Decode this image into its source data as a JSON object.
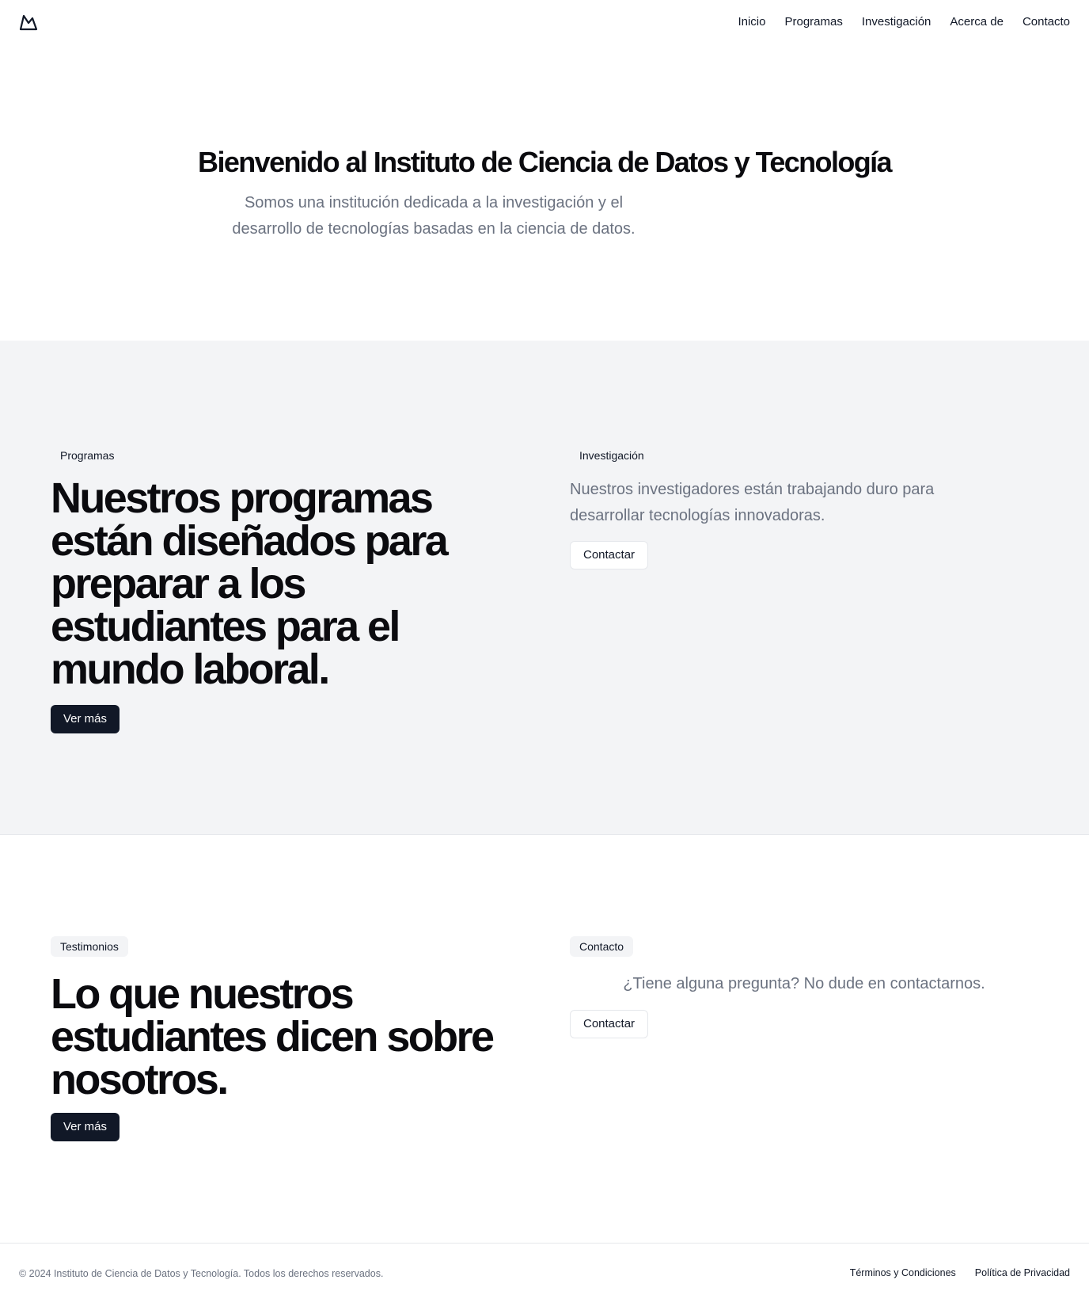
{
  "header": {
    "logo_icon": "mountain-icon",
    "nav": [
      "Inicio",
      "Programas",
      "Investigación",
      "Acerca de",
      "Contacto"
    ]
  },
  "hero": {
    "title": "Bienvenido al Instituto de Ciencia de Datos y Tecnología",
    "subtitle": "Somos una institución dedicada a la investigación y el desarrollo de tecnologías basadas en la ciencia de datos."
  },
  "programs": {
    "badge": "Programas",
    "title": "Nuestros programas están diseñados para preparar a los estudiantes para el mundo laboral.",
    "button": "Ver más"
  },
  "research": {
    "badge": "Investigación",
    "text": "Nuestros investigadores están trabajando duro para desarrollar tecnologías innovadoras.",
    "button": "Contactar"
  },
  "testimonials": {
    "badge": "Testimonios",
    "title": "Lo que nuestros estudiantes dicen sobre nosotros.",
    "button": "Ver más"
  },
  "contact": {
    "badge": "Contacto",
    "text": "¿Tiene alguna pregunta? No dude en contactarnos.",
    "button": "Contactar"
  },
  "footer": {
    "copyright": "© 2024 Instituto de Ciencia de Datos y Tecnología. Todos los derechos reservados.",
    "links": [
      "Términos y Condiciones",
      "Política de Privacidad"
    ]
  },
  "colors": {
    "primary_dark": "#111827",
    "muted_text": "#6b7280",
    "section_gray": "#f3f4f6"
  }
}
